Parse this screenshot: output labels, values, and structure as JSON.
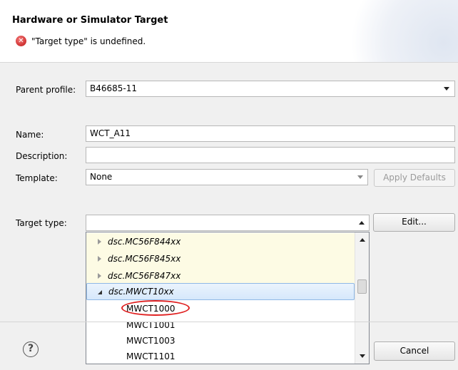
{
  "header": {
    "title": "Hardware or Simulator Target",
    "error_icon": "error-icon",
    "message": "\"Target type\" is undefined."
  },
  "form": {
    "parent_profile_label": "Parent profile:",
    "parent_profile_value": "B46685-11",
    "name_label": "Name:",
    "name_value": "WCT_A11",
    "description_label": "Description:",
    "description_value": "",
    "template_label": "Template:",
    "template_value": "None",
    "apply_defaults_label": "Apply Defaults",
    "target_type_label": "Target type:",
    "target_type_value": "",
    "edit_label": "Edit..."
  },
  "dropdown": {
    "items": [
      {
        "label": "dsc.MC56F844xx",
        "kind": "group",
        "expanded": false
      },
      {
        "label": "dsc.MC56F845xx",
        "kind": "group",
        "expanded": false
      },
      {
        "label": "dsc.MC56F847xx",
        "kind": "group",
        "expanded": false
      },
      {
        "label": "dsc.MWCT10xx",
        "kind": "group",
        "expanded": true,
        "selected": true
      },
      {
        "label": "MWCT1000",
        "kind": "leaf",
        "circled": true
      },
      {
        "label": "MWCT1001",
        "kind": "leaf"
      },
      {
        "label": "MWCT1003",
        "kind": "leaf"
      },
      {
        "label": "MWCT1101",
        "kind": "leaf"
      }
    ]
  },
  "footer": {
    "help_icon": "help-icon",
    "cancel_label": "Cancel"
  },
  "colors": {
    "highlight_row": "#fdfbe4",
    "selected_row": "#d6e8fb",
    "annotation_circle": "#e02020"
  }
}
